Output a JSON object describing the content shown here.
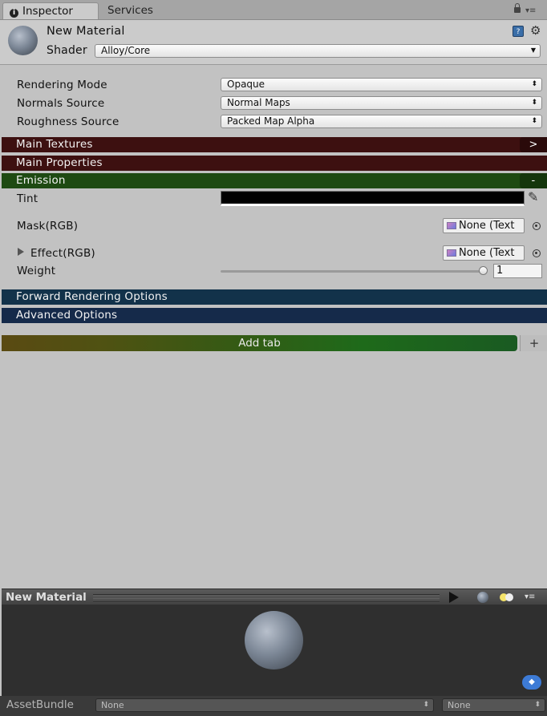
{
  "tabs": {
    "inspector": "Inspector",
    "services": "Services"
  },
  "header": {
    "material_name": "New Material",
    "shader_label": "Shader",
    "shader_value": "Alloy/Core"
  },
  "props": {
    "rendering_mode": {
      "label": "Rendering Mode",
      "value": "Opaque"
    },
    "normals_source": {
      "label": "Normals Source",
      "value": "Normal Maps"
    },
    "roughness_source": {
      "label": "Roughness Source",
      "value": "Packed Map Alpha"
    }
  },
  "sections": {
    "main_textures": {
      "label": "Main Textures",
      "button": ">",
      "color": "#3d1010"
    },
    "main_properties": {
      "label": "Main Properties",
      "color": "#3d1010"
    },
    "emission": {
      "label": "Emission",
      "button": "-",
      "color": "#1e4a12"
    },
    "forward_rendering": {
      "label": "Forward Rendering Options",
      "color": "#12324a"
    },
    "advanced": {
      "label": "Advanced Options",
      "color": "#152a4a"
    }
  },
  "emission": {
    "tint_label": "Tint",
    "tint_color": "#000000",
    "mask_label": "Mask(RGB)",
    "mask_value": "None (Text",
    "effect_label": "Effect(RGB)",
    "effect_value": "None (Text",
    "weight_label": "Weight",
    "weight_value": "1"
  },
  "add_tab": {
    "label": "Add tab",
    "plus": "+"
  },
  "preview": {
    "title": "New Material"
  },
  "assetbundle": {
    "label": "AssetBundle",
    "bundle_value": "None",
    "variant_value": "None"
  }
}
